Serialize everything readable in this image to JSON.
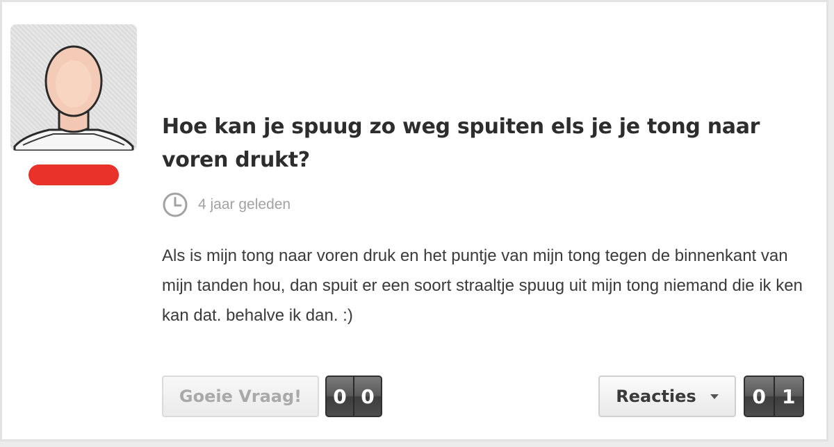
{
  "question": {
    "title": "Hoe kan je spuug zo weg spuiten els je je tong naar voren drukt?",
    "timestamp": "4 jaar geleden",
    "body": "Als is mijn tong naar voren druk en het puntje van mijn tong tegen de binnenkant van mijn tanden hou, dan spuit er een soort straaltje spuug uit mijn tong niemand die ik ken kan dat. behalve ik dan. :)"
  },
  "author": {
    "avatar_icon": "default-user-avatar-icon",
    "username_redaction_color": "#e8322a"
  },
  "actions": {
    "goeie_vraag_label": "Goeie Vraag!",
    "goeie_vraag_count": [
      "0",
      "0"
    ],
    "reacties_label": "Reacties",
    "reacties_count": [
      "0",
      "1"
    ]
  },
  "icons": {
    "clock": "clock-icon",
    "dropdown": "caret-down-icon"
  },
  "colors": {
    "accent_redaction": "#e8322a",
    "counter_background": "#5d5d5d",
    "title_text": "#2d2d2d",
    "meta_text": "#a2a2a2"
  }
}
